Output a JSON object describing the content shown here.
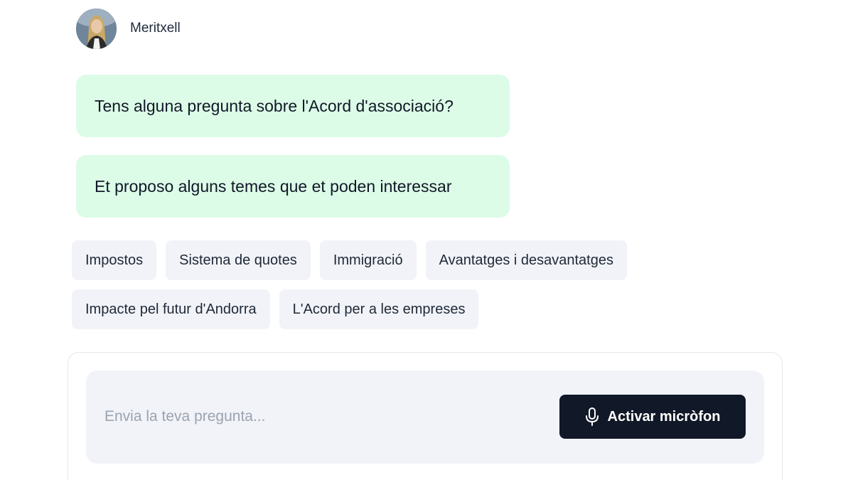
{
  "agent": {
    "name": "Meritxell",
    "avatar_icon": "person-avatar"
  },
  "messages": [
    {
      "text": "Tens alguna pregunta sobre l'Acord d'associació?"
    },
    {
      "text": "Et proposo alguns temes que et poden interessar"
    }
  ],
  "suggestions": [
    {
      "label": "Impostos"
    },
    {
      "label": "Sistema de quotes"
    },
    {
      "label": "Immigració"
    },
    {
      "label": "Avantatges i desavantatges"
    },
    {
      "label": "Impacte pel futur d'Andorra"
    },
    {
      "label": "L'Acord per a les empreses"
    }
  ],
  "composer": {
    "placeholder": "Envia la teva pregunta...",
    "value": "",
    "mic_button_label": "Activar micròfon",
    "mic_icon": "microphone-icon"
  },
  "colors": {
    "bubble_background": "#dcfce7",
    "chip_background": "#f1f3f8",
    "button_background": "#111827"
  }
}
